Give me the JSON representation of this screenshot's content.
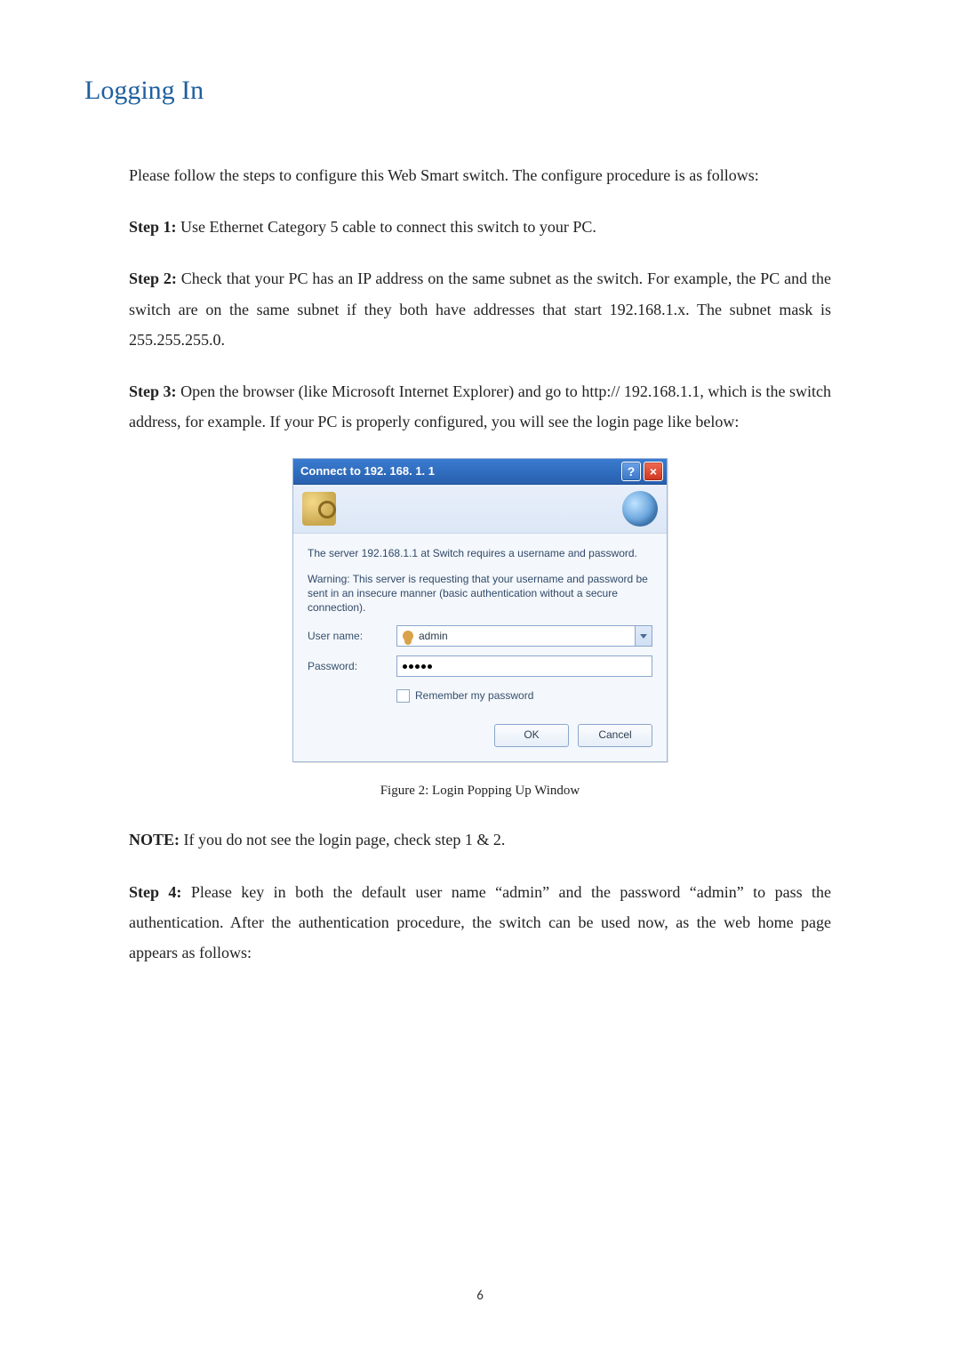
{
  "heading": "Logging In",
  "intro": "Please follow the steps to configure this Web Smart switch. The configure procedure is as follows:",
  "step1_label": "Step 1:",
  "step1_text": " Use Ethernet Category 5 cable to connect this switch to your PC.",
  "step2_label": "Step 2:",
  "step2_text": " Check that your PC has an IP address on the same subnet as the switch. For example, the PC and the switch are on the same subnet if they both have addresses that start 192.168.1.x. The subnet mask is 255.255.255.0.",
  "step3_label": "Step 3:",
  "step3_text": " Open the browser (like Microsoft Internet Explorer) and go to http:// 192.168.1.1, which is the switch address, for example. If your PC is properly configured, you will see the login page like below:",
  "dialog": {
    "title": "Connect to 192. 168. 1. 1",
    "msg1": "The server 192.168.1.1 at Switch requires a username and password.",
    "msg2": "Warning: This server is requesting that your username and password be sent in an insecure manner (basic authentication without a secure connection).",
    "user_label": "User name:",
    "user_value": "admin",
    "password_label": "Password:",
    "remember_label": "Remember my password",
    "ok_label": "OK",
    "cancel_label": "Cancel"
  },
  "figure_caption": "Figure 2: Login Popping Up Window",
  "note_label": "NOTE:",
  "note_text": " If you do not see the login page, check step 1 & 2.",
  "step4_label": "Step 4:",
  "step4_text": " Please key in both the default user name “admin” and the password “admin” to pass the authentication. After the authentication procedure, the switch can be used now, as the web home page appears as follows:",
  "page_number": "6"
}
